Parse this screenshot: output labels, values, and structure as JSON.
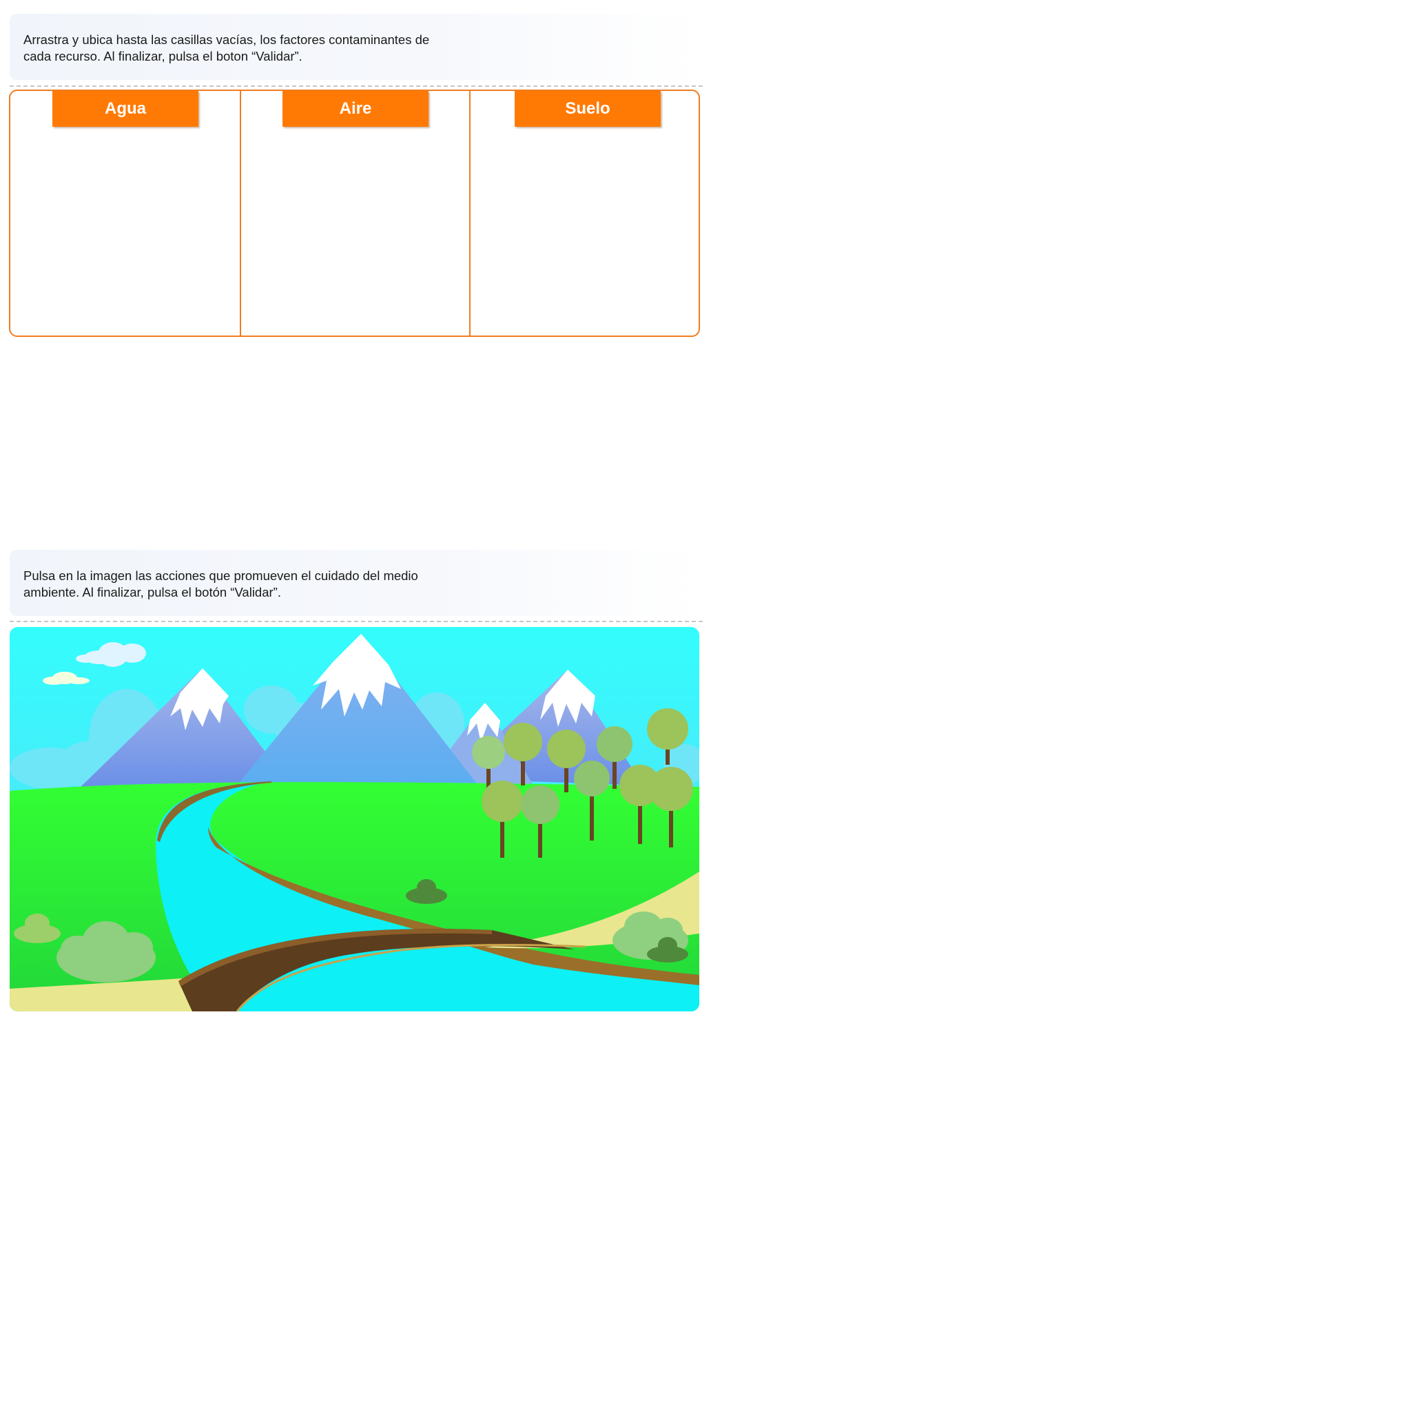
{
  "activity1": {
    "instruction_line1": "Arrastra y ubica hasta las casillas vacías, los factores contaminantes de",
    "instruction_line2": "cada recurso. Al finalizar, pulsa el boton “Validar”.",
    "columns": [
      {
        "label": "Agua"
      },
      {
        "label": "Aire"
      },
      {
        "label": "Suelo"
      }
    ],
    "header_color": "#ff7a05",
    "border_color": "#f07c20"
  },
  "activity2": {
    "instruction_line1": "Pulsa en la imagen las acciones que promueven el cuidado del medio",
    "instruction_line2": "ambiente. Al finalizar, pulsa el botón “Validar”.",
    "scene_colors": {
      "sky": "#33fdfd",
      "mountain": "#7b9de8",
      "snow": "#ffffff",
      "grass": "#33f533",
      "river": "#0df0f5",
      "road": "#5c3d1e",
      "sand": "#e8e68e",
      "tree_leaves": "#9dc35b",
      "tree_trunk": "#6b4423"
    }
  }
}
